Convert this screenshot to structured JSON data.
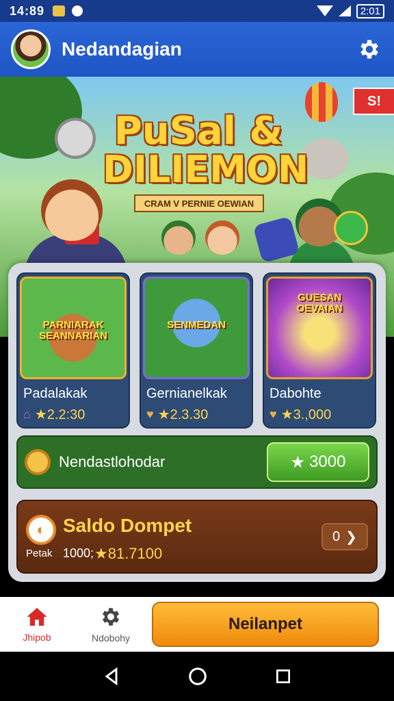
{
  "status_bar": {
    "time": "14:89",
    "battery": "2:01"
  },
  "header": {
    "title": "Nedandagian"
  },
  "banner": {
    "title_line1": "PuSal &",
    "title_line2": "DILIEMON",
    "subtitle": "CRAM V PERNIE OEWIAN",
    "ribbon": "S!"
  },
  "cards": [
    {
      "thumb_text": "PARNIARAK SEANNARIAN",
      "name": "Padalakak",
      "value": "★2.2:30"
    },
    {
      "thumb_text": "SENMEDAN",
      "name": "Gernianelkak",
      "value": "★2.3.30"
    },
    {
      "thumb_text": "GUESAN OEVAIAN",
      "name": "Dabohte",
      "value": "★3.,000"
    }
  ],
  "reward": {
    "label": "Nendastlohodar",
    "button": "3000"
  },
  "wallet": {
    "title": "Saldo Dompet",
    "sub_label": "Petak",
    "id": "1000;",
    "value": "★81.7100",
    "button": "0"
  },
  "bottom_nav": {
    "home_label": "Jhipob",
    "settings_label": "Ndobohy",
    "cta_label": "Neilanpet"
  },
  "colors": {
    "header": "#2a66d6",
    "accent": "#f08a0a",
    "reward_green": "#2d6f26",
    "wallet_brown": "#6a3214"
  }
}
